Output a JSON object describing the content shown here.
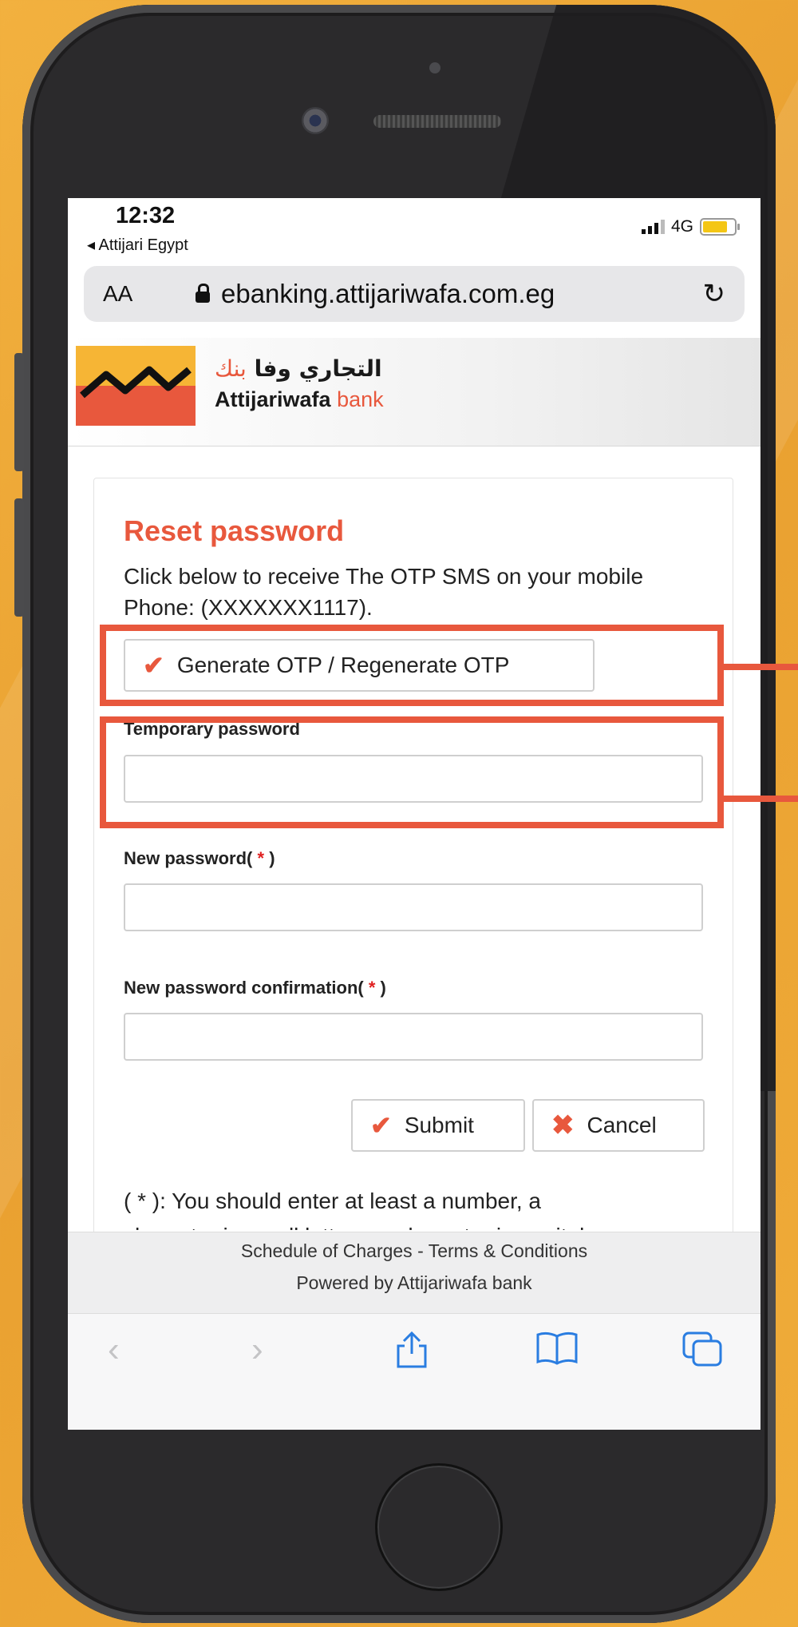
{
  "status": {
    "time": "12:32",
    "carrier": "◂ Attijari Egypt",
    "network": "4G"
  },
  "browser": {
    "text_size": "AA",
    "url": "ebanking.attijariwafa.com.eg"
  },
  "brand": {
    "arabic_main": "التجاري وفا",
    "arabic_red": "بنك",
    "english_main": "Attijariwafa",
    "english_red": "bank"
  },
  "form": {
    "title": "Reset password",
    "description": "Click below to receive The OTP SMS on your mobile Phone: (XXXXXXX1117).",
    "otp_button": "Generate OTP / Regenerate OTP",
    "temp_label": "Temporary password",
    "new_label": "New password(",
    "confirm_label": "New password confirmation(",
    "required_mark": "*",
    "close_paren": ")",
    "submit": "Submit",
    "cancel": "Cancel",
    "note": "( * ): You should enter at least a number, a",
    "note_cut": "character in small letters, a character in capital"
  },
  "footer": {
    "links": "Schedule of Charges - Terms & Conditions",
    "powered": "Powered by Attijariwafa bank"
  },
  "icons": {
    "back": "chevron-left-icon",
    "forward": "chevron-right-icon",
    "share": "share-icon",
    "bookmarks": "book-icon",
    "tabs": "tabs-icon"
  },
  "colors": {
    "accent": "#e8583d",
    "link_blue": "#2a7de1",
    "background": "#f0ad3a"
  }
}
